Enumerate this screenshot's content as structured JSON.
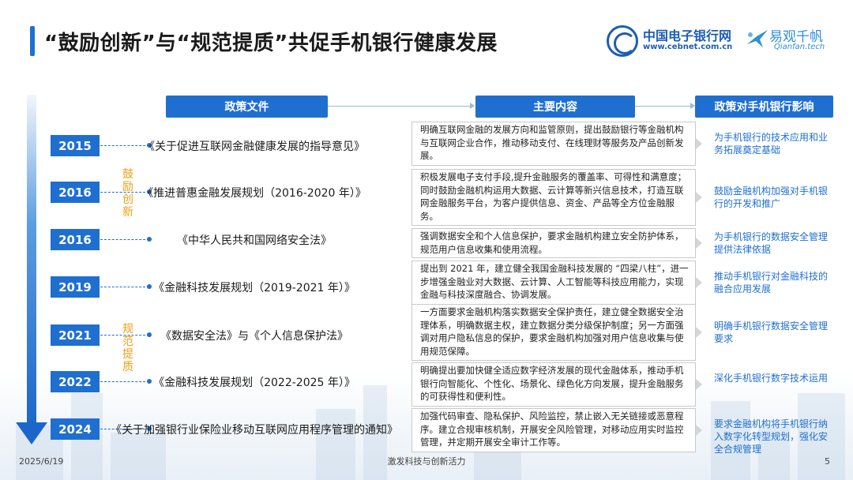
{
  "title": "“鼓励创新”与“规范提质”共促手机银行健康发展",
  "logo_cebnet": {
    "cn": "中国电子银行网",
    "en": "www.cebnet.com.cn"
  },
  "logo_qianfan": {
    "cn": "易观千帆",
    "en": "Qianfan.tech"
  },
  "headers": {
    "policy": "政策文件",
    "content": "主要内容",
    "impact": "政策对手机银行影响"
  },
  "stages": {
    "encourage": "鼓励创新",
    "regulate": "规范提质"
  },
  "rows": [
    {
      "year": "2015",
      "policy": "《关于促进互联网金融健康发展的指导意见》",
      "content": "明确互联网金融的发展方向和监管原则，提出鼓励银行等金融机构与互联网企业合作，推动移动支付、在线理财等服务及产品创新发展。",
      "impact": "为手机银行的技术应用和业务拓展奠定基础"
    },
    {
      "year": "2016",
      "policy": "《推进普惠金融发展规划（2016-2020 年）》",
      "content": "积极发展电子支付手段,提升金融服务的覆盖率、可得性和满意度；同时鼓励金融机构运用大数据、云计算等新兴信息技术，打造互联网金融服务平台，为客户提供信息、资金、产品等全方位金融服务。",
      "impact": "鼓励金融机构加强对手机银行的开发和推广"
    },
    {
      "year": "2016",
      "policy": "《中华人民共和国网络安全法》",
      "content": "强调数据安全和个人信息保护，要求金融机构建立安全防护体系，规范用户信息收集和使用流程。",
      "impact": "为手机银行的数据安全管理提供法律依据"
    },
    {
      "year": "2019",
      "policy": "《金融科技发展规划（2019-2021 年）》",
      "content": "提出到 2021 年，建立健全我国金融科技发展的 “四梁八柱”，进一步增强金融业对大数据、云计算、人工智能等科技应用能力，实现金融与科技深度融合、协调发展。",
      "impact": "推动手机银行对金融科技的融合应用发展"
    },
    {
      "year": "2021",
      "policy": "《数据安全法》与《个人信息保护法》",
      "content": "一方面要求金融机构落实数据安全保护责任，建立健全数据安全治理体系，明确数据主权，建立数据分类分级保护制度；另一方面强调对用户隐私信息的保护，要求金融机构加强对用户信息收集与使用规范保障。",
      "impact": "明确手机银行数据安全管理要求"
    },
    {
      "year": "2022",
      "policy": "《金融科技发展规划（2022-2025 年）》",
      "content": "明确提出要加快健全适应数字经济发展的现代金融体系，推动手机银行向智能化、个性化、场景化、绿色化方向发展，提升金融服务的可获得性和便利性。",
      "impact": "深化手机银行数字技术运用"
    },
    {
      "year": "2024",
      "policy": "《关于加强银行业保险业移动互联网应用程序管理的通知》",
      "content": "加强代码审查、隐私保护、风险监控，禁止嵌入无关链接或恶意程序。建立合规审核机制，开展安全风险管理，对移动应用实时监控管理，并定期开展安全审计工作等。",
      "impact": "要求金融机构将手机银行纳入数字化转型规划，强化安全合规管理"
    }
  ],
  "footer": {
    "date": "2025/6/19",
    "slogan": "激发科技与创新活力",
    "page": "5"
  }
}
